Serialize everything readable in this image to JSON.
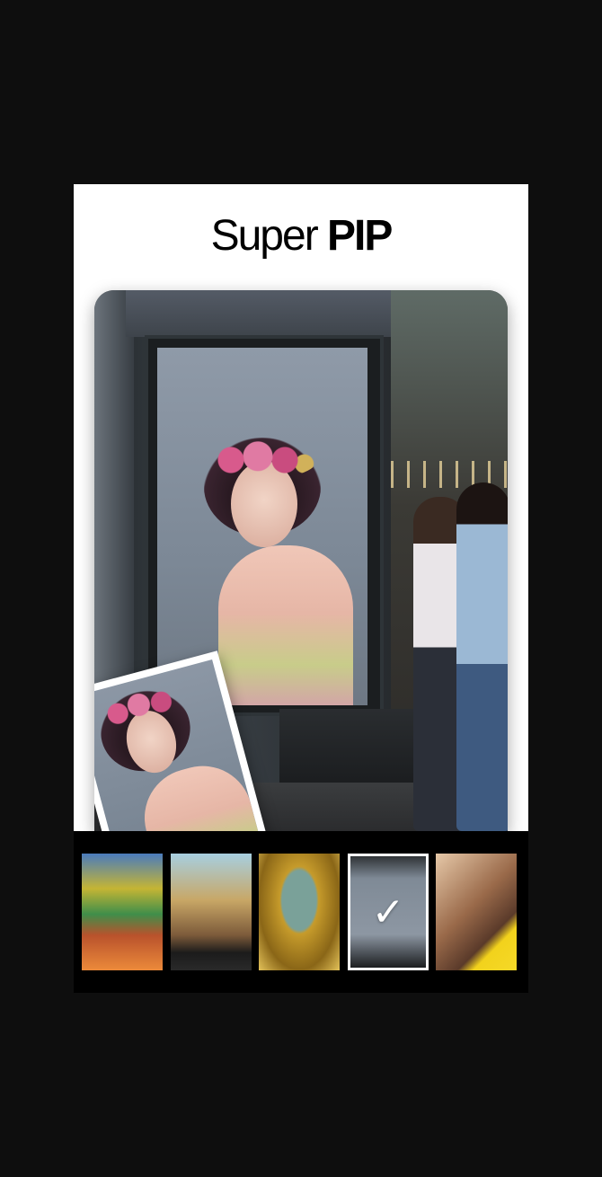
{
  "header": {
    "title_thin": "Super",
    "title_bold": "PIP"
  },
  "filmstrip": {
    "items": [
      {
        "name": "x-camera-collage"
      },
      {
        "name": "street-window"
      },
      {
        "name": "gold-frame"
      },
      {
        "name": "billboard",
        "selected": true
      },
      {
        "name": "yellow-book"
      }
    ],
    "check_glyph": "✓"
  }
}
